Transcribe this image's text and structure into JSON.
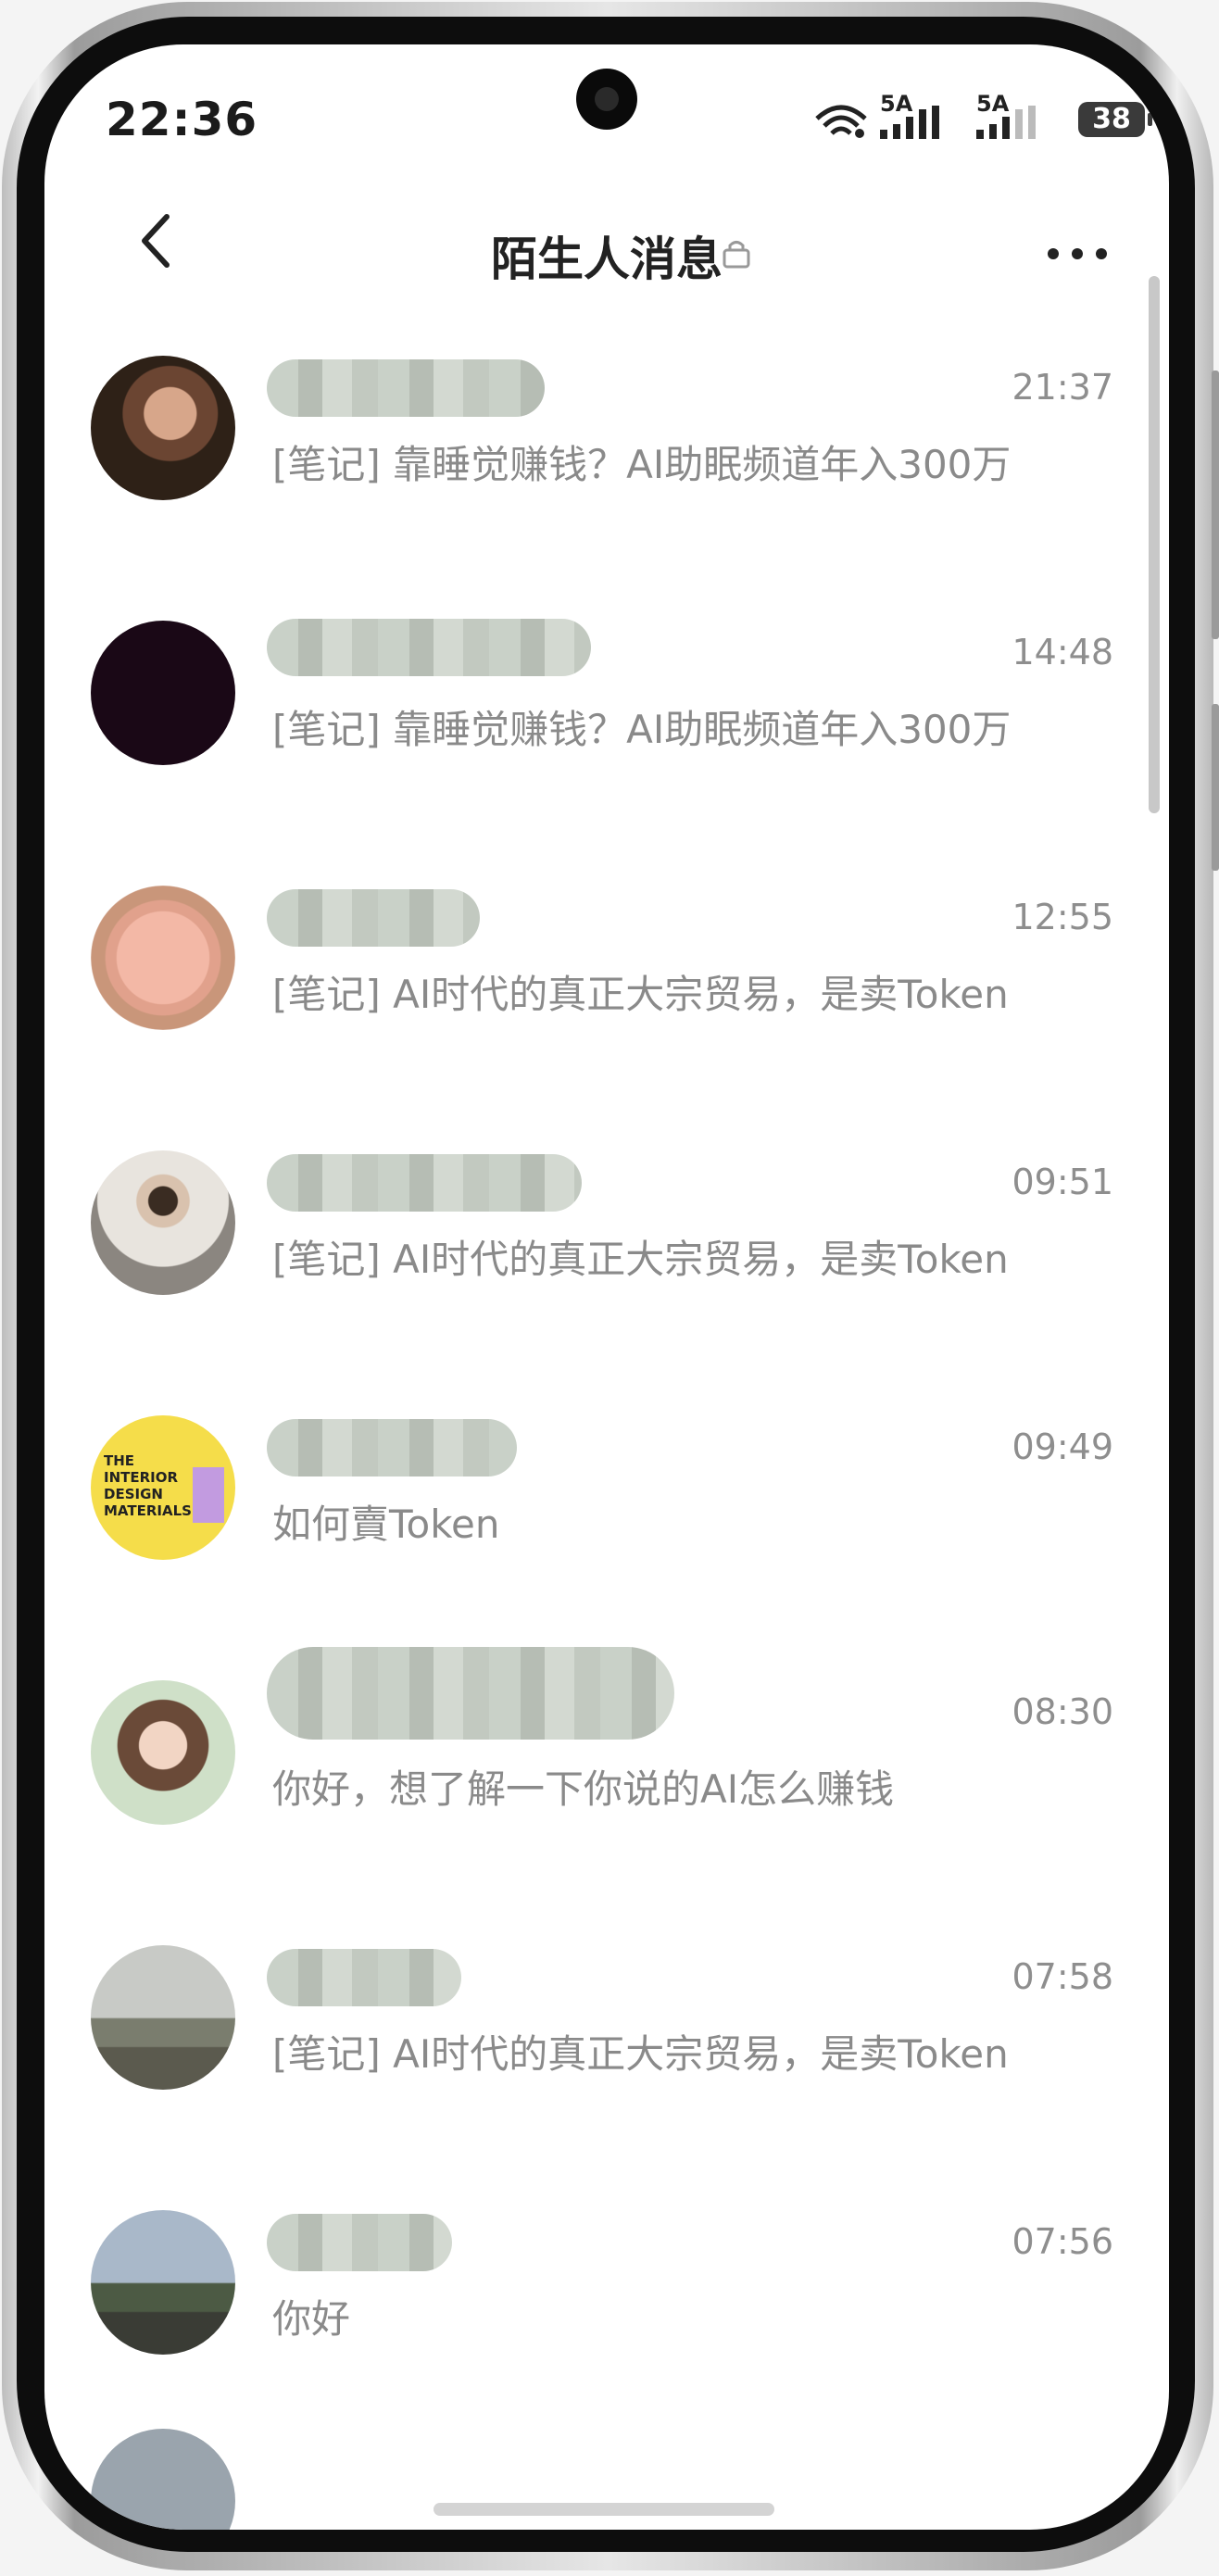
{
  "status_bar": {
    "time": "22:36",
    "network_1": "5A",
    "network_2": "5A",
    "battery": "38"
  },
  "header": {
    "title": "陌生人消息",
    "back_icon": "chevron-left-icon",
    "lock_icon": "lock-icon",
    "more_icon": "more-horizontal-icon"
  },
  "messages": [
    {
      "time": "21:37",
      "preview": "[笔记] 靠睡觉赚钱？AI助眠频道年入300万"
    },
    {
      "time": "14:48",
      "preview": "[笔记] 靠睡觉赚钱？AI助眠频道年入300万"
    },
    {
      "time": "12:55",
      "preview": "[笔记] AI时代的真正大宗贸易，是卖Token"
    },
    {
      "time": "09:51",
      "preview": "[笔记] AI时代的真正大宗贸易，是卖Token"
    },
    {
      "time": "09:49",
      "preview": "如何賣Token"
    },
    {
      "time": "08:30",
      "preview": "你好，想了解一下你说的AI怎么赚钱"
    },
    {
      "time": "07:58",
      "preview": "[笔记] AI时代的真正大宗贸易，是卖Token"
    },
    {
      "time": "07:56",
      "preview": "你好"
    }
  ],
  "avatar_4_text": {
    "line1": "THE",
    "line2": "INTERIOR",
    "line3": "DESIGN",
    "line4": "MATERIALS"
  }
}
